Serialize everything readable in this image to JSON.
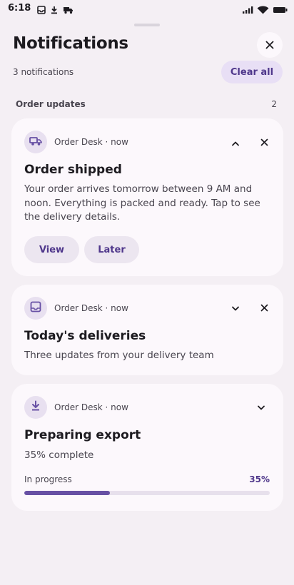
{
  "status_bar": {
    "time": "6:18"
  },
  "header": {
    "title": "Notifications",
    "count": "3 notifications",
    "clear_all": "Clear all"
  },
  "section": {
    "label": "Order updates",
    "count": "2"
  },
  "notifications": [
    {
      "app": "Order Desk · now",
      "icon": "truck-icon",
      "title": "Order shipped",
      "body": "Your order arrives tomorrow between 9 AM and noon. Everything is packed and ready. Tap to see the delivery details.",
      "actions": [
        "View",
        "Later"
      ],
      "expanded": true
    },
    {
      "app": "Order Desk · now",
      "icon": "inbox-icon",
      "title": "Today's deliveries",
      "body": "Three updates from your delivery team",
      "expanded": false
    },
    {
      "app": "Order Desk · now",
      "icon": "download-icon",
      "title": "Preparing export",
      "body": "35% complete",
      "progress_label": "In progress",
      "progress_text": "35%",
      "progress": 0.35,
      "expanded": false
    }
  ],
  "colors": {
    "accent": "#6750a4",
    "accent_text": "#4f378b",
    "background": "#f4eff4",
    "card": "#fcf8fc"
  }
}
